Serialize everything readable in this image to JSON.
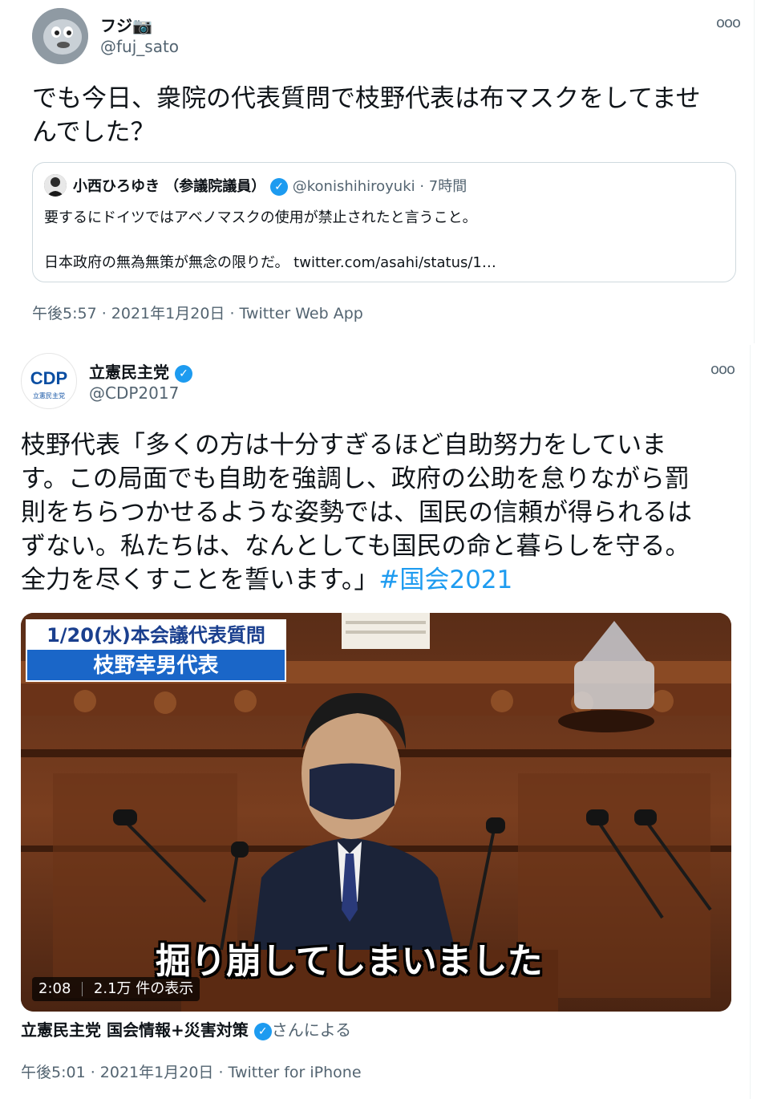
{
  "tweet1": {
    "name": "フジ📷",
    "handle": "@fuj_sato",
    "text_line1": "でも今日、衆院の代表質問で枝野代表は布マスクをしてませ",
    "text_line2": "んでした？",
    "quote": {
      "name": "小西ひろゆき （参議院議員）",
      "handle_time": "@konishihiroyuki · 7時間",
      "line1": "要するにドイツではアベノマスクの使用が禁止されたと言うこと。",
      "line2": "日本政府の無為無策が無念の限りだ。 twitter.com/asahi/status/1…"
    },
    "meta": "午後5:57 · 2021年1月20日 · Twitter Web App",
    "more_icon": "ooo"
  },
  "tweet2": {
    "name": "立憲民主党",
    "handle": "@CDP2017",
    "logo_text": "CDP",
    "logo_sub": "立憲民主党",
    "lines": [
      "枝野代表「多くの方は十分すぎるほど自助努力をしていま",
      "す。この局面でも自助を強調し、政府の公助を怠りながら罰",
      "則をちらつかせるような姿勢では、国民の信頼が得られるは",
      "ずない。私たちは、なんとしても国民の命と暮らしを守る。",
      "全力を尽くすことを誓います。」"
    ],
    "hashtag": "#国会2021",
    "video": {
      "title_line1": "1/20(水)本会議代表質問",
      "title_line2": "枝野幸男代表",
      "subtitle": "掘り崩してしまいました",
      "duration": "2:08",
      "views": "2.1万 件の表示"
    },
    "caption_name": "立憲民主党 国会情報+災害対策",
    "caption_suffix": "さんによる",
    "meta": "午後5:01 · 2021年1月20日 · Twitter for iPhone",
    "more_icon": "ooo"
  },
  "colors": {
    "accent": "#1d9bf0",
    "muted": "#536471"
  }
}
